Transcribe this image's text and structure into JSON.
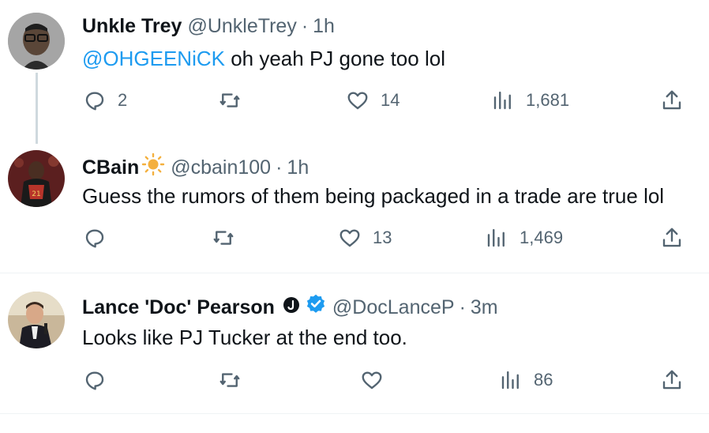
{
  "tweets": [
    {
      "name": "Unkle Trey",
      "handle": "@UnkleTrey",
      "dot": "·",
      "time": "1h",
      "mention": "@OHGEENiCK",
      "text": " oh yeah PJ gone too lol",
      "replies": "2",
      "retweets": "",
      "likes": "14",
      "views": "1,681"
    },
    {
      "name": "CBain",
      "name_emoji": "sun-emoji",
      "handle": "@cbain100",
      "dot": "·",
      "time": "1h",
      "text": "Guess the rumors of them being packaged in a trade are true lol",
      "replies": "",
      "retweets": "",
      "likes": "13",
      "views": "1,469"
    },
    {
      "name": "Lance 'Doc' Pearson",
      "badges": [
        "circle-j-badge",
        "verified-badge"
      ],
      "handle": "@DocLanceP",
      "dot": "·",
      "time": "3m",
      "text": "Looks like PJ Tucker at the end too.",
      "replies": "",
      "retweets": "",
      "likes": "",
      "views": "86"
    }
  ],
  "colors": {
    "accent": "#1d9bf0",
    "secondary_text": "#536471",
    "primary_text": "#0f1419",
    "thread_line": "#cfd9de",
    "sun": "#f4b03e"
  },
  "icons": [
    "reply-icon",
    "retweet-icon",
    "like-icon",
    "views-icon",
    "share-icon"
  ]
}
